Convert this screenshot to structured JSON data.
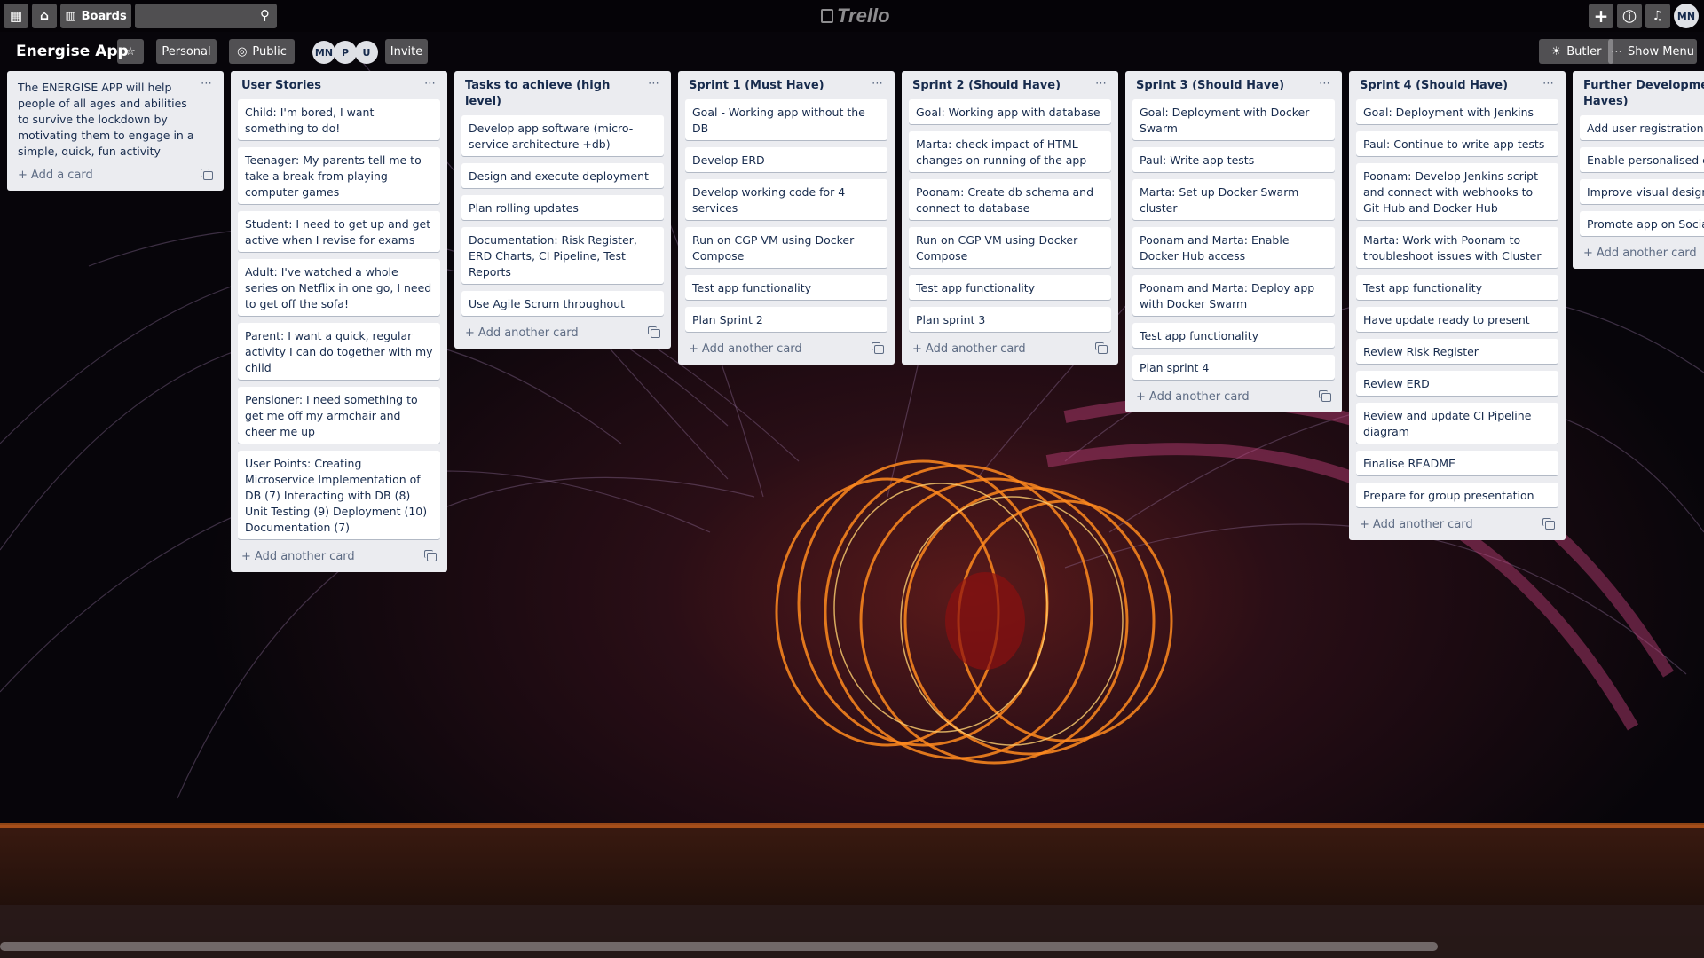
{
  "topbar": {
    "boards_label": "Boards",
    "logo_text": "Trello",
    "user_initials": "MN"
  },
  "board": {
    "title": "Energise App",
    "personal_label": "Personal",
    "public_label": "Public",
    "members": [
      "MN",
      "P",
      "U"
    ],
    "invite_label": "Invite",
    "butler_label": "Butler",
    "show_menu_label": "Show Menu"
  },
  "lists": [
    {
      "title": "",
      "description": "The ENERGISE APP will help people of all ages and abilities to survive the lockdown by motivating them to engage in a simple, quick, fun activity",
      "cards": [],
      "add_label": "Add a card"
    },
    {
      "title": "User Stories",
      "cards": [
        "Child: I'm bored, I want something to do!",
        "Teenager: My parents tell me to take a break from playing computer games",
        "Student: I need to get up and get active when I revise for exams",
        "Adult: I've watched a whole series on Netflix in one go, I need to get off the sofa!",
        "Parent: I want a quick, regular activity I can do together with my child",
        "Pensioner: I need something to get me off my armchair and cheer me up",
        "User Points: Creating Microservice Implementation of DB (7) Interacting with DB (8) Unit Testing (9) Deployment (10) Documentation (7)"
      ],
      "add_label": "Add another card"
    },
    {
      "title": "Tasks to achieve (high level)",
      "cards": [
        "Develop app software (micro-service architecture +db)",
        "Design and execute deployment",
        "Plan rolling updates",
        "Documentation: Risk Register, ERD Charts, CI Pipeline, Test Reports",
        "Use Agile Scrum throughout"
      ],
      "add_label": "Add another card"
    },
    {
      "title": "Sprint 1 (Must Have)",
      "cards": [
        "Goal - Working app without the DB",
        "Develop ERD",
        "Develop working code for 4 services",
        "Run on CGP VM using Docker Compose",
        "Test app functionality",
        "Plan Sprint 2"
      ],
      "add_label": "Add another card"
    },
    {
      "title": "Sprint 2 (Should Have)",
      "cards": [
        "Goal: Working app with database",
        "Marta: check impact of HTML changes on running of the app",
        "Poonam: Create db schema and connect to database",
        "Run on CGP VM using Docker Compose",
        "Test app functionality",
        "Plan sprint 3"
      ],
      "add_label": "Add another card"
    },
    {
      "title": "Sprint 3 (Should Have)",
      "cards": [
        "Goal: Deployment with Docker Swarm",
        "Paul: Write app tests",
        "Marta: Set up Docker Swarm cluster",
        "Poonam and Marta: Enable Docker Hub access",
        "Poonam and Marta: Deploy app with Docker Swarm",
        "Test app functionality",
        "Plan sprint 4"
      ],
      "add_label": "Add another card"
    },
    {
      "title": "Sprint 4 (Should Have)",
      "cards": [
        "Goal: Deployment with Jenkins",
        "Paul: Continue to write app tests",
        "Poonam: Develop Jenkins script and connect with webhooks to Git Hub and Docker Hub",
        "Marta: Work with Poonam to troubleshoot issues with Cluster",
        "Test app functionality",
        "Have update ready to present",
        "Review Risk Register",
        "Review ERD",
        "Review and update CI Pipeline diagram",
        "Finalise README",
        "Prepare for group presentation"
      ],
      "add_label": "Add another card"
    },
    {
      "title": "Further Development (C Would Haves)",
      "cards": [
        "Add user registration",
        "Enable personalised con",
        "Improve visual design",
        "Promote app on Social M"
      ],
      "add_label": "Add another card"
    }
  ]
}
